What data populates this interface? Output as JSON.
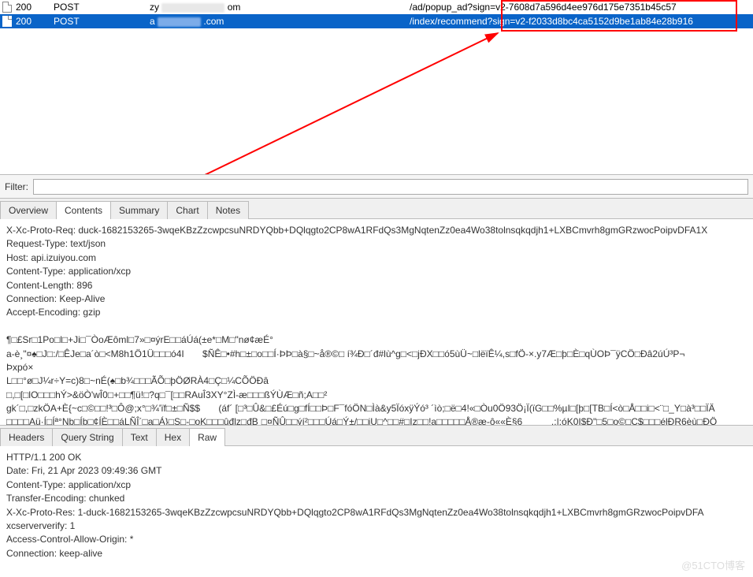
{
  "requests": [
    {
      "status": "200",
      "method": "POST",
      "host_prefix": "zy",
      "host_blurred": "xxxxxxxx",
      "host_suffix": "om",
      "path": "/ad/popup_ad?sign=v2-7608d7a596d4ee976d175e7351b45c57",
      "selected": false
    },
    {
      "status": "200",
      "method": "POST",
      "host_prefix": "a",
      "host_blurred": "xxxxxx",
      "host_suffix": ".com",
      "path": "/index/recommend?sign=v2-f2033d8bc4ca5152d9be1ab84e28b916",
      "selected": true
    }
  ],
  "filter": {
    "label": "Filter:",
    "value": ""
  },
  "tabs_top": {
    "items": [
      "Overview",
      "Contents",
      "Summary",
      "Chart",
      "Notes"
    ],
    "active": "Contents"
  },
  "request_text": "X-Xc-Proto-Req: duck-1682153265-3wqeKBzZzcwpcsuNRDYQbb+DQlqgto2CP8wA1RFdQs3MgNqtenZz0ea4Wo38tolnsqkqdjh1+LXBCmvrh8gmGRzwocPoipvDFA1X\nRequest-Type: text/json\nHost: api.izuiyou.com\nContent-Type: application/xcp\nContent-Length: 896\nConnection: Keep-Alive\nAccept-Encoding: gzip\n\n¶□£Sr□1Po□l□+Ji□¯ÒoÆôml□7»□¤ýrE□□áÚá(±e*□M□\"nø¢æÉ°\na-è¸\"¤♠□J□:/□ÊJe□a´ò□<M8h1Ö1Ü□□□ó4I       $ÑÊ□•#h□±□o□□Í·ÞÞ□à§□~å®©□ í¾Đ□´đ#lù^g□<□jĐX□□ó5ùÜ~□lëïÊ¼,s□fÖ-×.y7Æ□þ□È□qÙOÞ¯ÿCÖ□Đâ2úÚ³P¬\nÞxpó×\nL□□°ø□J¼r÷Y=c)8□~nÉ(♠□b¾□□□ÃÕ□þÖØRÀ4□Ç□¼CÕÖĐâ\n□,□[□lO□□□hÝ>&öÒ'wÎ0□+□□¶ü!□?q□¯[□□RAuÎ3XY°ZÌ-æ□□□ßÝÙÆ□ñ;A□□²\ngk´□,□zkÖA+È{~c□©□□!³□Ô@;x°□¾'ïf□±□Ñ$$       (áf´ [□³□Û&□£Éú□g□fÍ□□Þ□F¯fóÖN□Ìà&y5ÏóxÿÝó³ ´ìò;□ë□4!«□Òu0Ö93Ö¡Ï(ïG□□%µI□[þ□[TB□Í<ò□Å□□i□<¨□_Y□à³□□ÏÄ\n□□□□Aü·Í□Íª°Nþ□Íþ□¢ÍÈ□□áLÑÎ´□a□Á}□S□-□oK□□□ûđlz□đB¸□¤ÑÛ□□ýí²□□□Úá□Ý±/□□jU□^□□#□Iz□□!a□□□□□Å®æ-ô««È§6           .:|:óK0I$Đ\"□5□o©□C$□□□élĐR6èù□ĐÖ",
  "tabs_bottom": {
    "items": [
      "Headers",
      "Query String",
      "Text",
      "Hex",
      "Raw"
    ],
    "active": "Raw"
  },
  "response_text": "HTTP/1.1 200 OK\nDate: Fri, 21 Apr 2023 09:49:36 GMT\nContent-Type: application/xcp\nTransfer-Encoding: chunked\nX-Xc-Proto-Res: 1-duck-1682153265-3wqeKBzZzcwpcsuNRDYQbb+DQlqgto2CP8wA1RFdQs3MgNqtenZz0ea4Wo38tolnsqkqdjh1+LXBCmvrh8gmGRzwocPoipvDFA\nxcserververify: 1\nAccess-Control-Allow-Origin: *\nConnection: keep-alive",
  "watermark": "@51CTO博客"
}
